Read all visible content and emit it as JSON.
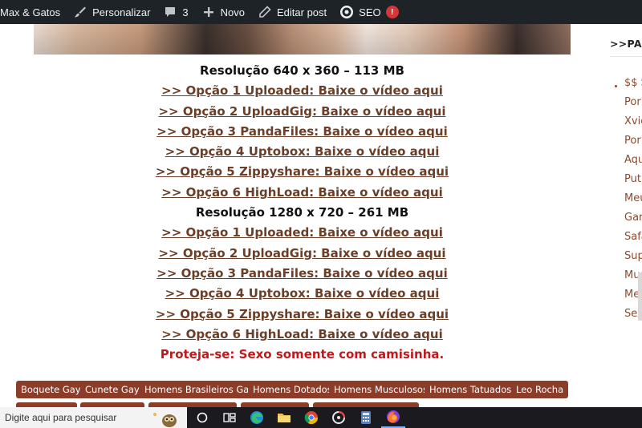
{
  "adminbar": {
    "site_name": "Max & Gatos",
    "customize": "Personalizar",
    "comments_count": "3",
    "new": "Novo",
    "edit_post": "Editar post",
    "seo": "SEO",
    "seo_badge": "!"
  },
  "content": {
    "blocks": [
      {
        "heading": "Resolução 640 x 360 – 113 MB",
        "links": [
          ">> Opção 1 Uploaded: Baixe o vídeo aqui",
          ">> Opção 2 UploadGig: Baixe o vídeo aqui",
          ">> Opção 3 PandaFiles: Baixe o vídeo aqui",
          ">> Opção 4 Uptobox: Baixe o vídeo aqui",
          ">> Opção 5 Zippyshare: Baixe o vídeo aqui",
          ">> Opção 6 HighLoad: Baixe o vídeo aqui"
        ]
      },
      {
        "heading": "Resolução 1280 x 720 – 261 MB",
        "links": [
          ">> Opção 1 Uploaded: Baixe o vídeo aqui",
          ">> Opção 2 UploadGig: Baixe o vídeo aqui",
          ">> Opção 3 PandaFiles: Baixe o vídeo aqui",
          ">> Opção 4 Uptobox: Baixe o vídeo aqui",
          ">> Opção 5 Zippyshare: Baixe o vídeo aqui",
          ">> Opção 6 HighLoad: Baixe o vídeo aqui"
        ]
      }
    ],
    "warning": "Proteja-se: Sexo somente com camisinha."
  },
  "tags": [
    "Boquete Gay",
    "Cunete Gay",
    "Homens Brasileiros Gay",
    "Homens Dotados",
    "Homens Musculosos",
    "Homens Tatuados",
    "Leo Rocha"
  ],
  "sidebar": {
    "title": ">>PARCE",
    "links": [
      "$$ S",
      "Por",
      "Xvid",
      "Por",
      "Aqu",
      "Put",
      "Meu",
      "Gar",
      "Safa",
      "Sup",
      "Mus",
      "Meu",
      "Sex"
    ]
  },
  "taskbar": {
    "search_placeholder": "Digite aqui para pesquisar"
  },
  "colors": {
    "admin_bg": "#1d2327",
    "link": "#6b3f27",
    "warning": "#c0181d",
    "tag_bg": "#8c3d2a",
    "taskbar_bg": "#1b1b1f"
  }
}
